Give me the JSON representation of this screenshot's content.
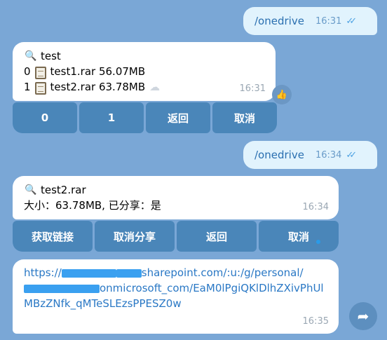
{
  "messages": {
    "out1": {
      "text": "/onedrive",
      "time": "16:31",
      "status_icon": "double-check-icon"
    },
    "in1": {
      "icon": "paperclip-icon",
      "title": "test",
      "files": [
        {
          "index": "0",
          "name": "test1.rar 56.07MB",
          "icon": "document-icon"
        },
        {
          "index": "1",
          "name": "test2.rar 63.78MB",
          "icon": "document-icon",
          "extra_icon": "cloud-icon"
        }
      ],
      "time": "16:31",
      "keyboard": [
        "0",
        "1",
        "返回",
        "取消"
      ],
      "reaction_icon": "thumbs-up-icon"
    },
    "out2": {
      "text": "/onedrive",
      "time": "16:34",
      "status_icon": "double-check-icon"
    },
    "in2": {
      "icon": "paperclip-icon",
      "title": "test2.rar",
      "details": "大小：63.78MB, 已分享：是",
      "time": "16:34",
      "keyboard": [
        "获取链接",
        "取消分享",
        "返回",
        "取消"
      ]
    },
    "in3": {
      "link_part1": "https://",
      "link_part2": "sharepoint.com/:u:/g/personal/",
      "link_part3": "onmicrosoft_com/EaM0lPgiQKlDlhZXivPhUlMBzZNfk_qMTeSLEzsPPESZ0w",
      "time": "16:35"
    }
  },
  "forward_icon": "share-arrow-icon",
  "colors": {
    "background": "#7aa7d6",
    "outgoing": "#e1f3fd",
    "incoming": "#ffffff",
    "keyboard_button": "#4a86b9",
    "link": "#2a78c5"
  }
}
